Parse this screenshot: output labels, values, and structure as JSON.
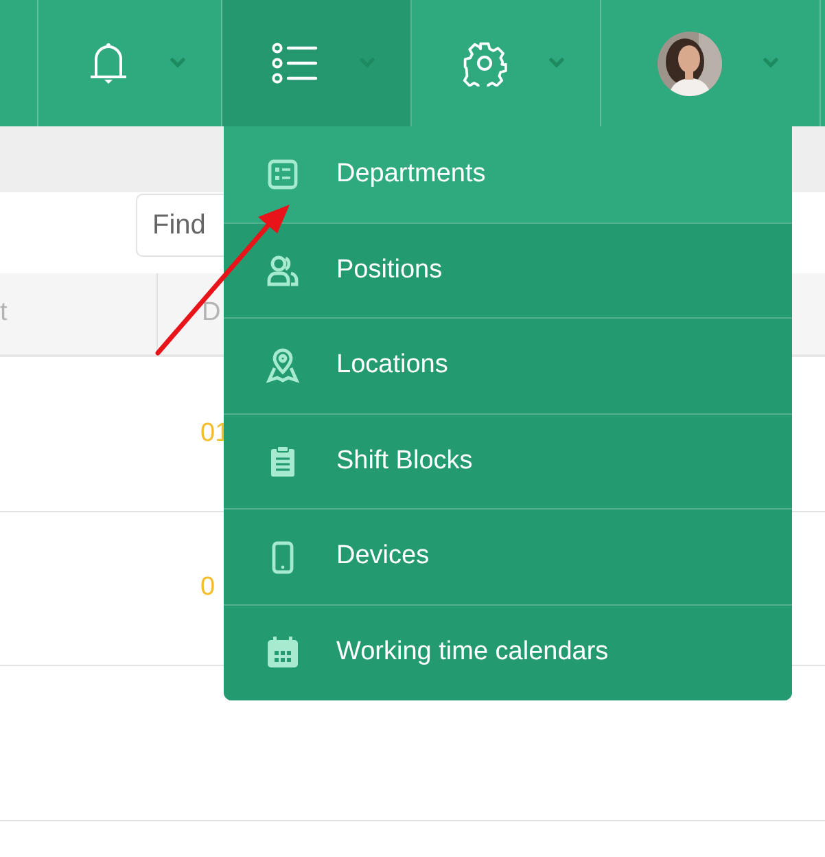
{
  "navbar": {
    "items": [
      {
        "kind": "notifications",
        "selected": false
      },
      {
        "kind": "lists",
        "selected": true
      },
      {
        "kind": "settings",
        "selected": false
      },
      {
        "kind": "profile",
        "selected": false
      }
    ]
  },
  "search": {
    "placeholder": "Find"
  },
  "table": {
    "columns": [
      "t",
      "D"
    ],
    "rows": [
      {
        "column_2": "01"
      },
      {
        "column_2": "0"
      }
    ]
  },
  "menu": {
    "items": [
      {
        "label": "Departments",
        "kind": "departments",
        "selected": true
      },
      {
        "label": "Positions",
        "kind": "positions",
        "selected": false
      },
      {
        "label": "Locations",
        "kind": "locations",
        "selected": false
      },
      {
        "label": "Shift Blocks",
        "kind": "shift-blocks",
        "selected": false
      },
      {
        "label": "Devices",
        "kind": "devices",
        "selected": false
      },
      {
        "label": "Working time calendars",
        "kind": "calendars",
        "selected": false
      }
    ]
  }
}
